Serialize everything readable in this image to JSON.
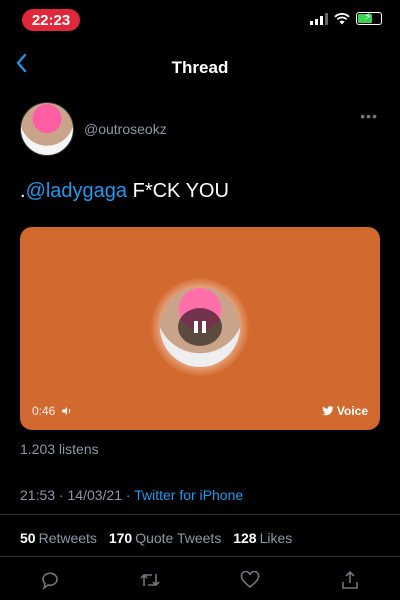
{
  "status": {
    "time": "22:23"
  },
  "nav": {
    "title": "Thread",
    "back_icon": "chevron-left-icon"
  },
  "author": {
    "handle": "@outroseokz"
  },
  "tweet": {
    "prefix": ".",
    "mention": "@ladygaga",
    "text": " F*CK YOU"
  },
  "voice": {
    "duration": "0:46",
    "brand": "Voice",
    "card_color": "#d2692f",
    "state": "playing"
  },
  "listens": "1.203 listens",
  "meta": {
    "time": "21:53",
    "sep": " · ",
    "date": "14/03/21",
    "source": "Twitter for iPhone"
  },
  "stats": [
    {
      "count": "50",
      "label": "Retweets"
    },
    {
      "count": "170",
      "label": "Quote Tweets"
    },
    {
      "count": "128",
      "label": "Likes"
    }
  ],
  "accent": "#1d9bf0"
}
